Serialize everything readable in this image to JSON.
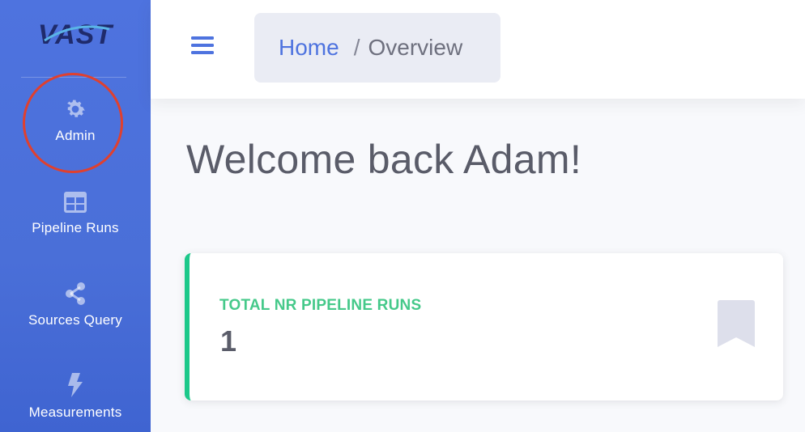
{
  "brand": {
    "logo_text": "VAST"
  },
  "sidebar": {
    "items": [
      {
        "label": "Admin",
        "icon": "gear-icon"
      },
      {
        "label": "Pipeline Runs",
        "icon": "table-icon"
      },
      {
        "label": "Sources Query",
        "icon": "share-icon"
      },
      {
        "label": "Measurements",
        "icon": "bolt-icon"
      }
    ]
  },
  "header": {
    "breadcrumb": {
      "home": "Home",
      "separator": "/",
      "current": "Overview"
    }
  },
  "main": {
    "welcome": "Welcome back Adam!",
    "cards": [
      {
        "title": "TOTAL NR PIPELINE RUNS",
        "value": "1",
        "icon": "bookmark-icon"
      }
    ]
  },
  "colors": {
    "sidebar": "#4e73df",
    "accent": "#4e73df",
    "success": "#1cc88a",
    "annotation": "#e0402e"
  }
}
